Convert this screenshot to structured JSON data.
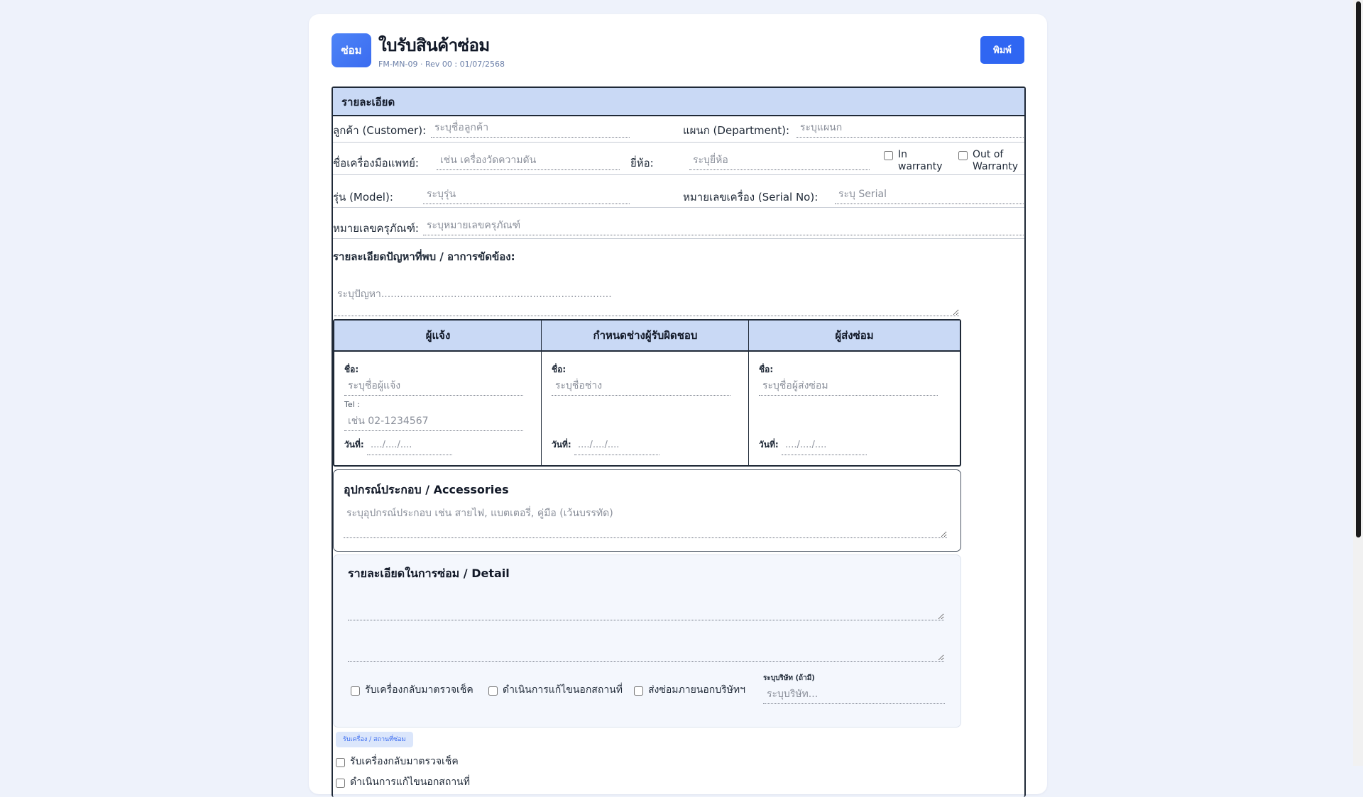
{
  "header": {
    "logo": "ซ่อม",
    "title": "ใบรับสินค้าซ่อม",
    "subtitle": "FM-MN-09 · Rev 00 : 01/07/2568",
    "print_label": "พิมพ์"
  },
  "details": {
    "section_title": "รายละเอียด",
    "customer_label": "ลูกค้า (Customer):",
    "customer_placeholder": "ระบุชื่อลูกค้า",
    "department_label": "แผนก (Department):",
    "department_placeholder": "ระบุแผนก",
    "device_label": "ชื่อเครื่องมือแพทย์:",
    "device_placeholder": "เช่น เครื่องวัดความดัน",
    "brand_label": "ยี่ห้อ:",
    "brand_placeholder": "ระบุยี่ห้อ",
    "in_warranty": "In warranty",
    "out_warranty": "Out of Warranty",
    "model_label": "รุ่น (Model):",
    "model_placeholder": "ระบุรุ่น",
    "serial_label": "หมายเลขเครื่อง (Serial No):",
    "serial_placeholder": "ระบุ Serial",
    "asset_label": "หมายเลขครุภัณฑ์:",
    "asset_placeholder": "ระบุหมายเลขครุภัณฑ์",
    "problem_label": "รายละเอียดปัญหาที่พบ / อาการขัดข้อง:",
    "problem_placeholder": "ระบุปัญหา........................................................................."
  },
  "people": {
    "reporter_title": "ผู้แจ้ง",
    "technician_title": "กำหนดช่างผู้รับผิดชอบ",
    "sender_title": "ผู้ส่งซ่อม",
    "name_label": "ชื่อ:",
    "reporter_placeholder": "ระบุชื่อผู้แจ้ง",
    "technician_placeholder": "ระบุชื่อช่าง",
    "sender_placeholder": "ระบุชื่อผู้ส่งซ่อม",
    "tel_label": "Tel :",
    "tel_placeholder": "เช่น 02-1234567",
    "date_label": "วันที่:",
    "date_placeholder": "..../..../...."
  },
  "accessories": {
    "title": "อุปกรณ์ประกอบ / Accessories",
    "placeholder": "ระบุอุปกรณ์ประกอบ เช่น สายไฟ, แบตเตอรี่, คู่มือ (เว้นบรรทัด)"
  },
  "repair": {
    "title": "รายละเอียดในการซ่อม / Detail",
    "opt_check": "รับเครื่องกลับมาตรวจเช็ค",
    "opt_onsite": "ดำเนินการแก้ไขนอกสถานที่",
    "opt_outsource": "ส่งซ่อมภายนอกบริษัทฯ",
    "company_label": "ระบุบริษัท (ถ้ามี)",
    "company_placeholder": "ระบุบริษัท..."
  },
  "location": {
    "pill": "รับเครื่อง / สถานที่ซ่อม",
    "opt_check": "รับเครื่องกลับมาตรวจเช็ค",
    "opt_onsite": "ดำเนินการแก้ไขนอกสถานที่"
  }
}
